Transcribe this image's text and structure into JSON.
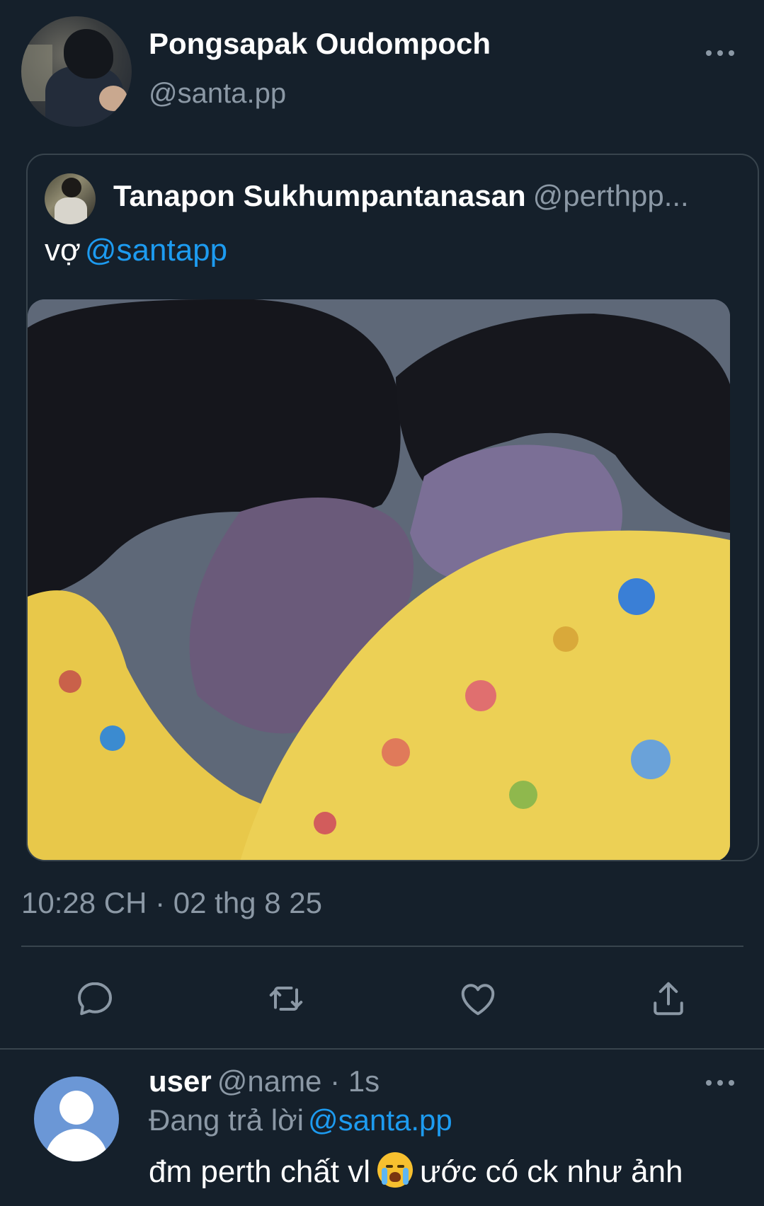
{
  "tweet": {
    "author_name": "Pongsapak Oudompoch",
    "author_handle": "@santa.pp",
    "timestamp": "10:28 CH · 02 thg 8 25"
  },
  "quoted_tweet": {
    "author_name": "Tanapon Sukhumpantanasan",
    "author_handle": "@perthpp...",
    "text": "vợ",
    "mention": "@santapp"
  },
  "actions": {
    "reply_icon": "reply-icon",
    "retweet_icon": "retweet-icon",
    "like_icon": "heart-icon",
    "share_icon": "share-icon"
  },
  "reply_preview": {
    "user_name": "user",
    "user_handle_time": "@name · 1s",
    "replying_label": "Đang trả lời",
    "replying_mention": "@santa.pp",
    "text_before_emoji": "đm perth chất vl",
    "emoji": "loudly-crying-face",
    "text_after_emoji": "ước có ck như ảnh"
  },
  "colors": {
    "background": "#15202b",
    "accent": "#1d9bf0",
    "secondary_text": "#8b98a5",
    "border": "#38444d"
  }
}
